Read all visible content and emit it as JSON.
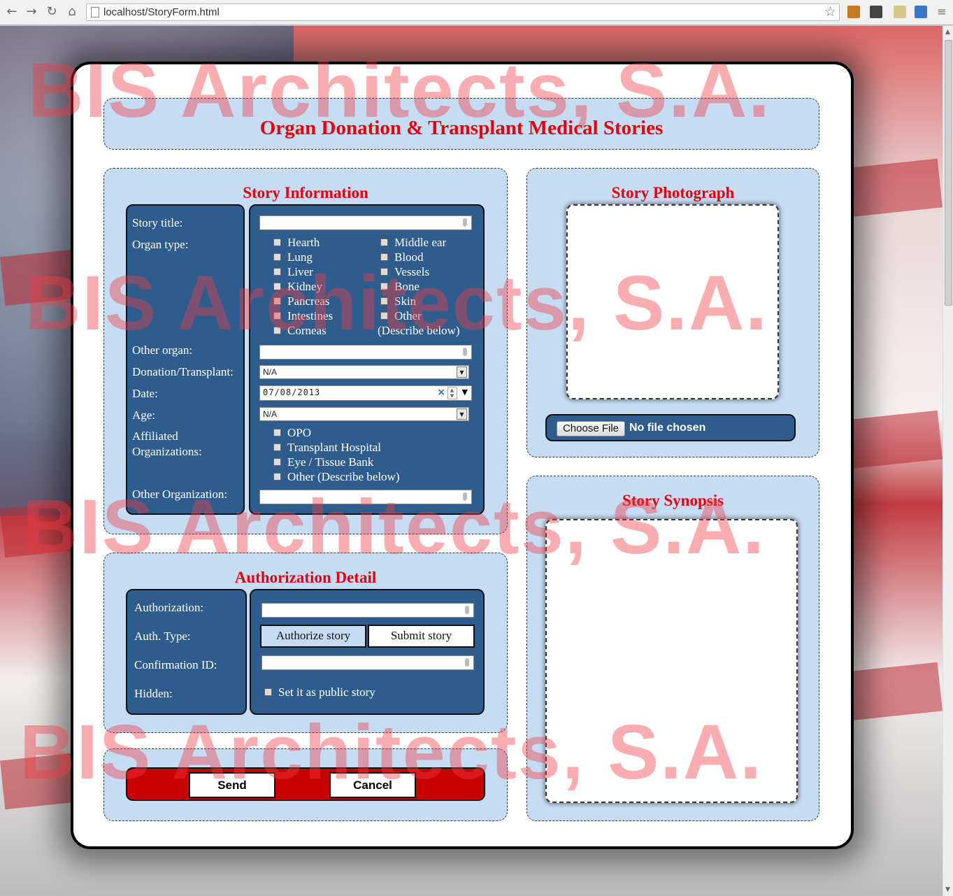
{
  "browser": {
    "url": "localhost/StoryForm.html"
  },
  "header": {
    "title": "Organ Donation & Transplant Medical Stories"
  },
  "story_info": {
    "title": "Story Information",
    "labels": {
      "story_title": "Story title:",
      "organ_type": "Organ type:",
      "other_organ": "Other organ:",
      "donation_transplant": "Donation/Transplant:",
      "date": "Date:",
      "age": "Age:",
      "affiliated_1": "Affiliated",
      "affiliated_2": "Organizations:",
      "other_org": "Other Organization:"
    },
    "organs_left": [
      "Hearth",
      "Lung",
      "Liver",
      "Kidney",
      "Pancreas",
      "Intestines",
      "Corneas"
    ],
    "organs_right": [
      "Middle ear",
      "Blood",
      "Vessels",
      "Bone",
      "Skin",
      "Other"
    ],
    "organs_note": "(Describe below)",
    "donation_transplant_value": "N/A",
    "date_value": "07/08/2013",
    "age_value": "N/A",
    "organizations": [
      "OPO",
      "Transplant Hospital",
      "Eye / Tissue Bank",
      "Other (Describe below)"
    ]
  },
  "photo": {
    "title": "Story Photograph",
    "choose_file": "Choose File",
    "no_file": "No file chosen"
  },
  "auth": {
    "title": "Authorization Detail",
    "labels": {
      "authorization": "Authorization:",
      "auth_type": "Auth. Type:",
      "confirmation": "Confirmation ID:",
      "hidden": "Hidden:"
    },
    "authorize_btn": "Authorize story",
    "submit_btn": "Submit story",
    "public_label": "Set it as public story"
  },
  "synopsis": {
    "title": "Story Synopsis"
  },
  "actions": {
    "send": "Send",
    "cancel": "Cancel"
  },
  "watermark": "BIS Architects, S.A."
}
